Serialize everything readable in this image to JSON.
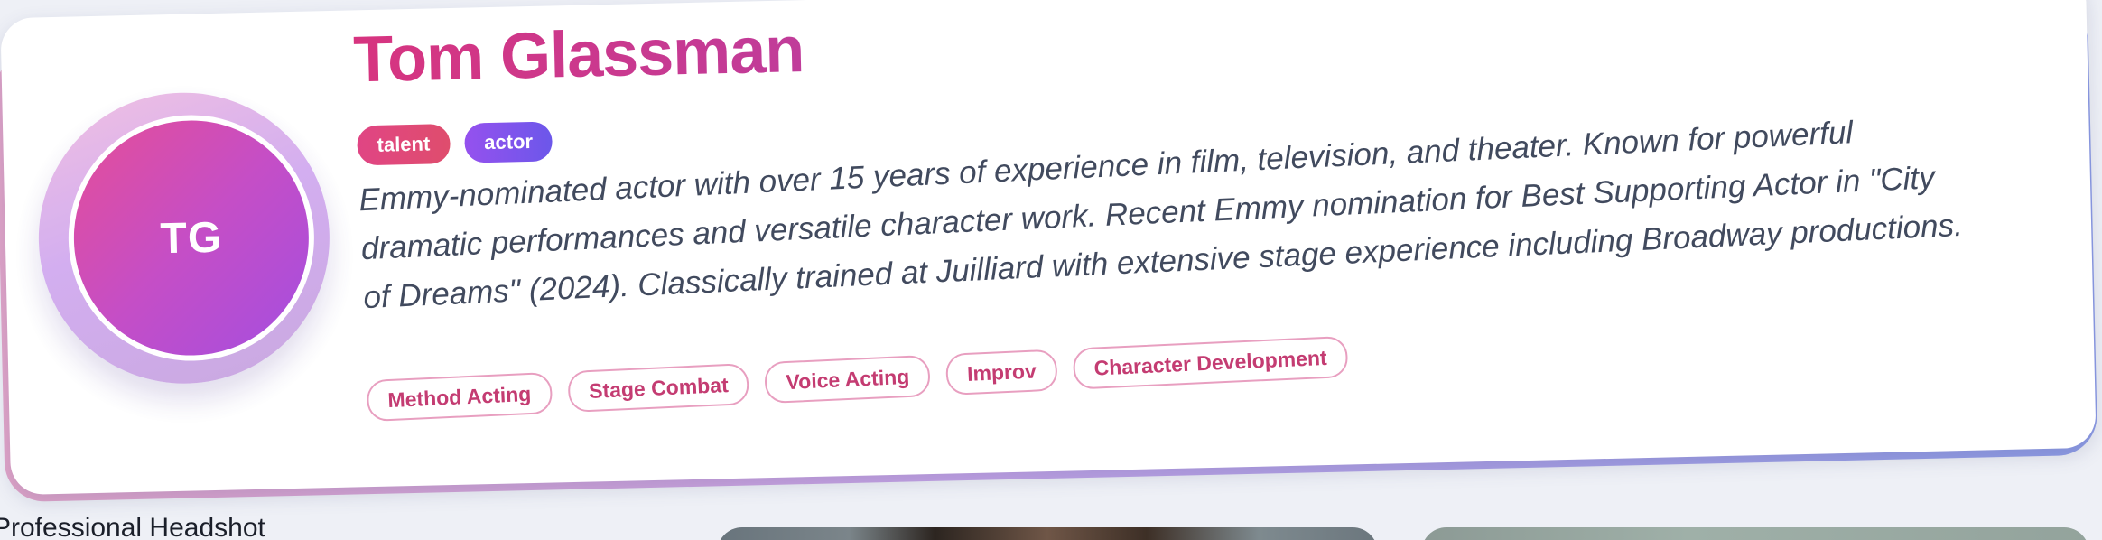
{
  "profile": {
    "initials": "TG",
    "name": "Tom Glassman",
    "roles": [
      "talent",
      "actor"
    ],
    "bio_lines": [
      "Emmy-nominated actor with over 15 years of experience in film, television, and theater. Known for powerful",
      "dramatic performances and versatile character work. Recent Emmy nomination for Best Supporting Actor in \"City",
      "of Dreams\" (2024). Classically trained at Juilliard with extensive stage experience including Broadway productions."
    ],
    "skills": [
      "Method Acting",
      "Stage Combat",
      "Voice Acting",
      "Improv",
      "Character Development"
    ]
  },
  "gallery": {
    "first_label": "Professional Headshot"
  },
  "colors": {
    "name_gradient_start": "#d7347f",
    "talent_tag": "#e04584",
    "actor_tag": "#8054ee",
    "skill_text": "#c43c72",
    "avatar_gradient_start": "#e54e98",
    "avatar_gradient_end": "#a44ee0"
  }
}
